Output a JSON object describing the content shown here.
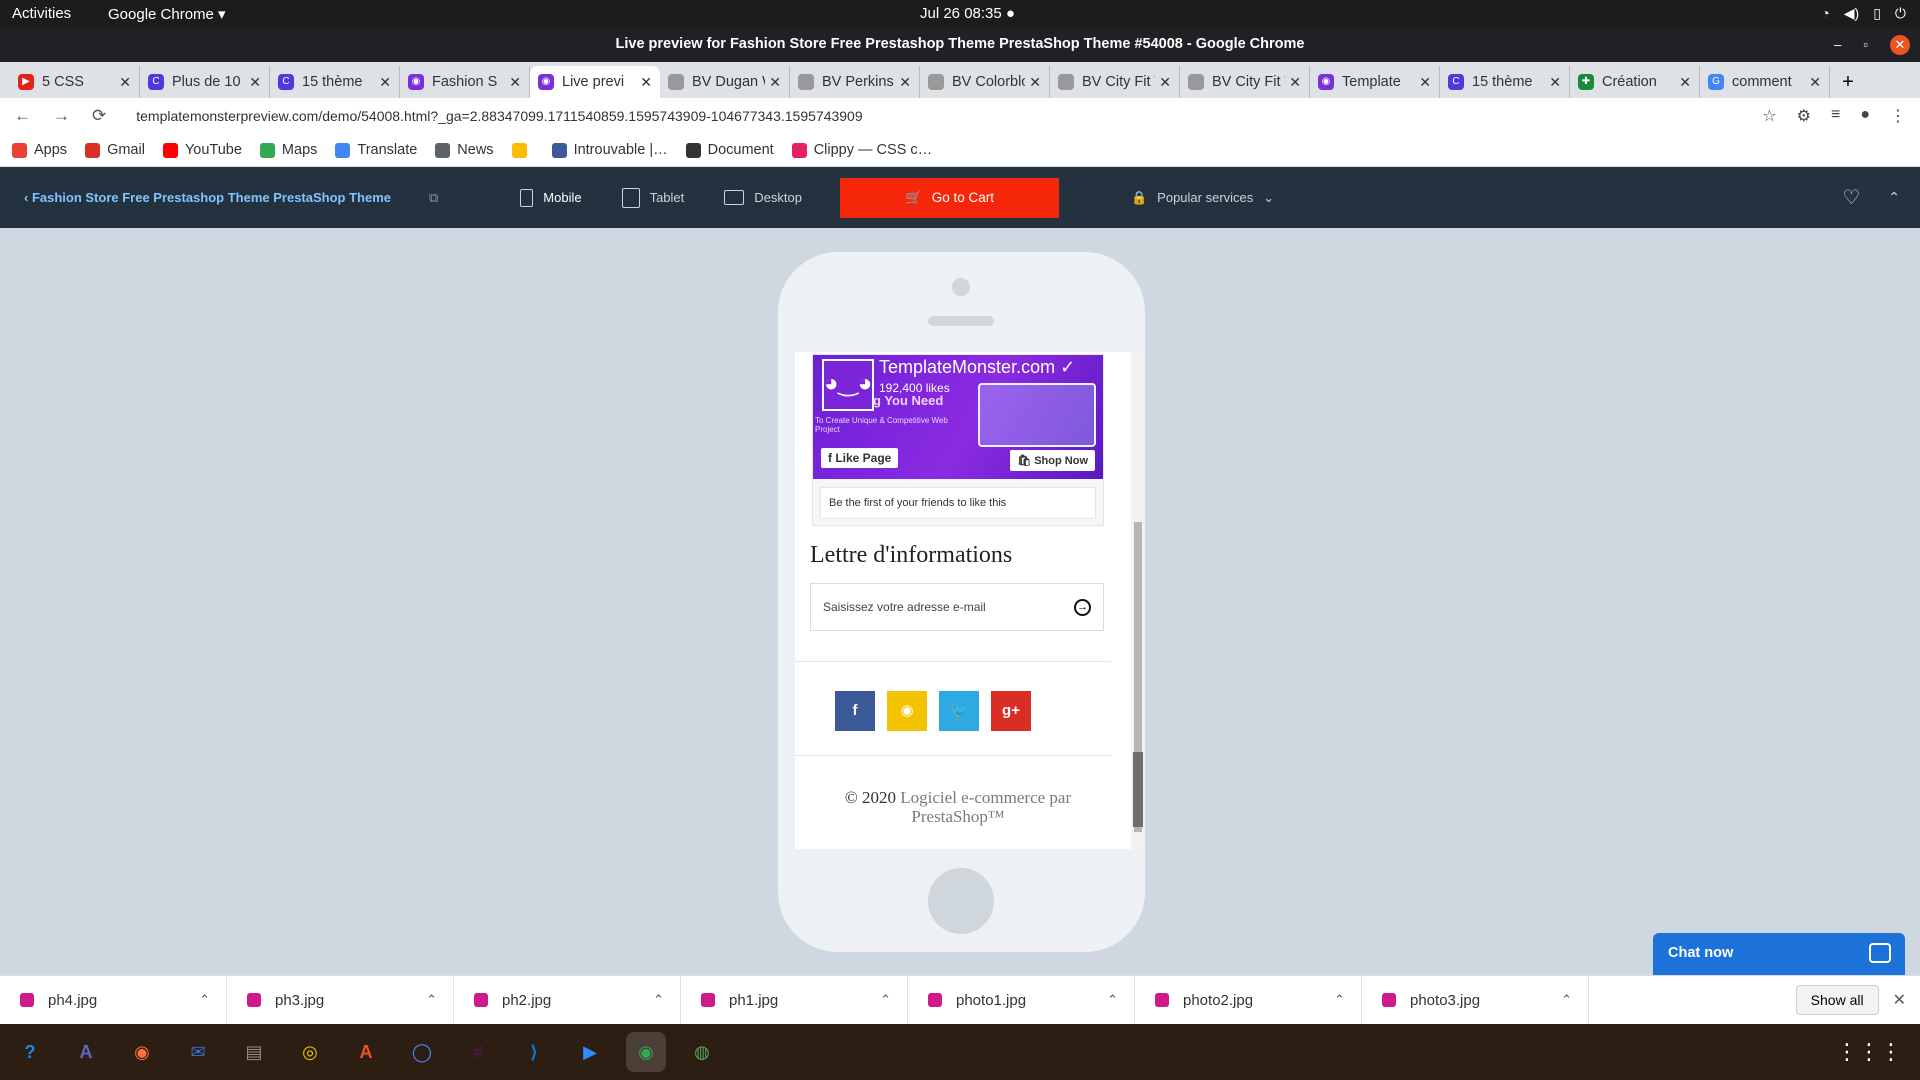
{
  "topbar": {
    "activities": "Activities",
    "app": "Google Chrome ▾",
    "clock": "Jul 26  08:35  ●",
    "sys": [
      "wifi",
      "vol",
      "batt",
      "power"
    ]
  },
  "window": {
    "title": "Live preview for Fashion Store Free Prestashop Theme PrestaShop Theme #54008 - Google Chrome",
    "min": "–",
    "max": "▫",
    "close": "✕"
  },
  "tabs": [
    {
      "label": "5 CSS",
      "color": "#e62117",
      "mark": "▶"
    },
    {
      "label": "Plus de 10",
      "color": "#4a3cdb",
      "mark": "C"
    },
    {
      "label": "15 thème",
      "color": "#4a3cdb",
      "mark": "C"
    },
    {
      "label": "Fashion S",
      "color": "#7c2fd8",
      "mark": "◉"
    },
    {
      "label": "Live previ",
      "color": "#7c2fd8",
      "mark": "◉"
    },
    {
      "label": "BV Dugan W",
      "color": "#999",
      "mark": ""
    },
    {
      "label": "BV Perkins P",
      "color": "#999",
      "mark": ""
    },
    {
      "label": "BV Colorbloc",
      "color": "#999",
      "mark": ""
    },
    {
      "label": "BV City Fit Tu",
      "color": "#999",
      "mark": ""
    },
    {
      "label": "BV City Fit Tu",
      "color": "#999",
      "mark": ""
    },
    {
      "label": "Template",
      "color": "#7c2fd8",
      "mark": "◉"
    },
    {
      "label": "15 thème",
      "color": "#4a3cdb",
      "mark": "C"
    },
    {
      "label": "Création",
      "color": "#1a8a3a",
      "mark": "✚"
    },
    {
      "label": "comment",
      "color": "#4285f4",
      "mark": "G"
    }
  ],
  "tab_close": "✕",
  "new_tab": "+",
  "address": {
    "url": "templatemonsterpreview.com/demo/54008.html?_ga=2.88347099.1711540859.1595743909-104677343.1595743909",
    "back": "←",
    "fwd": "→",
    "reload": "⟳",
    "lock": "🔒",
    "star": "☆"
  },
  "bookmarks": [
    {
      "label": "Apps",
      "color": "#e94235"
    },
    {
      "label": "Gmail",
      "color": "#d93025"
    },
    {
      "label": "YouTube",
      "color": "#ff0000"
    },
    {
      "label": "Maps",
      "color": "#34a853"
    },
    {
      "label": "Translate",
      "color": "#4285f4"
    },
    {
      "label": "News",
      "color": "#5f6368"
    },
    {
      "label": "",
      "color": "#fbbc04"
    },
    {
      "label": "Introuvable |…",
      "color": "#3c5a99"
    },
    {
      "label": "Document",
      "color": "#333333"
    },
    {
      "label": "Clippy — CSS c…",
      "color": "#e91e63"
    }
  ],
  "tmbar": {
    "back": "‹  Fashion Store Free Prestashop Theme PrestaShop Theme",
    "ext": "⧉",
    "mobile": "Mobile",
    "tablet": "Tablet",
    "desktop": "Desktop",
    "cart": "Go to Cart",
    "cart_icon": "🛒",
    "popular": "Popular services",
    "lock": "🔒",
    "chev": "⌄",
    "heart": "♡",
    "up": "⌃"
  },
  "fb": {
    "name": "TemplateMonster.com ✓",
    "likes": "192,400 likes",
    "headline": "g You Need",
    "sub": "To Create Unique & Competitive Web Project",
    "like_btn": "f  Like Page",
    "shop_btn": "🛍 Shop Now",
    "friends": "Be the first of your friends to like this",
    "logo": "◕‿◕"
  },
  "newsletter": {
    "title": "Lettre d'informations",
    "placeholder": "Saisissez votre adresse e-mail",
    "go": "→"
  },
  "social": [
    {
      "name": "facebook",
      "glyph": "f",
      "color": "#3b5998"
    },
    {
      "name": "rss",
      "glyph": "◉",
      "color": "#f3c300"
    },
    {
      "name": "twitter",
      "glyph": "🐦",
      "color": "#2daae1"
    },
    {
      "name": "google-plus",
      "glyph": "g+",
      "color": "#d92d26"
    }
  ],
  "footer": {
    "copyright": "© 2020 ",
    "link": "Logiciel e-commerce par PrestaShop™"
  },
  "chat": {
    "label": "Chat now"
  },
  "downloads": [
    {
      "name": "ph4.jpg"
    },
    {
      "name": "ph3.jpg"
    },
    {
      "name": "ph2.jpg"
    },
    {
      "name": "ph1.jpg"
    },
    {
      "name": "photo1.jpg"
    },
    {
      "name": "photo2.jpg"
    },
    {
      "name": "photo3.jpg"
    }
  ],
  "download_chevron": "⌃",
  "show_all": "Show all",
  "dl_close": "✕",
  "dock": [
    {
      "name": "help",
      "glyph": "?",
      "color": "#1e88e5"
    },
    {
      "name": "translate",
      "glyph": "A",
      "color": "#5c6bc0"
    },
    {
      "name": "firefox",
      "glyph": "◉",
      "color": "#ff7139"
    },
    {
      "name": "thunderbird",
      "glyph": "✉",
      "color": "#2f6fd3"
    },
    {
      "name": "files",
      "glyph": "▤",
      "color": "#8d8d8d"
    },
    {
      "name": "rhythmbox",
      "glyph": "◎",
      "color": "#f5c400"
    },
    {
      "name": "software",
      "glyph": "A",
      "color": "#e95420"
    },
    {
      "name": "chromium",
      "glyph": "◯",
      "color": "#4a8af4"
    },
    {
      "name": "slack",
      "glyph": "#",
      "color": "#4a154b"
    },
    {
      "name": "vscode",
      "glyph": "⟩",
      "color": "#0078d4"
    },
    {
      "name": "zoom",
      "glyph": "▶",
      "color": "#2d8cff"
    },
    {
      "name": "chrome",
      "glyph": "◉",
      "color": "#34a853"
    },
    {
      "name": "network",
      "glyph": "◍",
      "color": "#5aa65a"
    }
  ],
  "dock_grid": "⋮⋮⋮"
}
